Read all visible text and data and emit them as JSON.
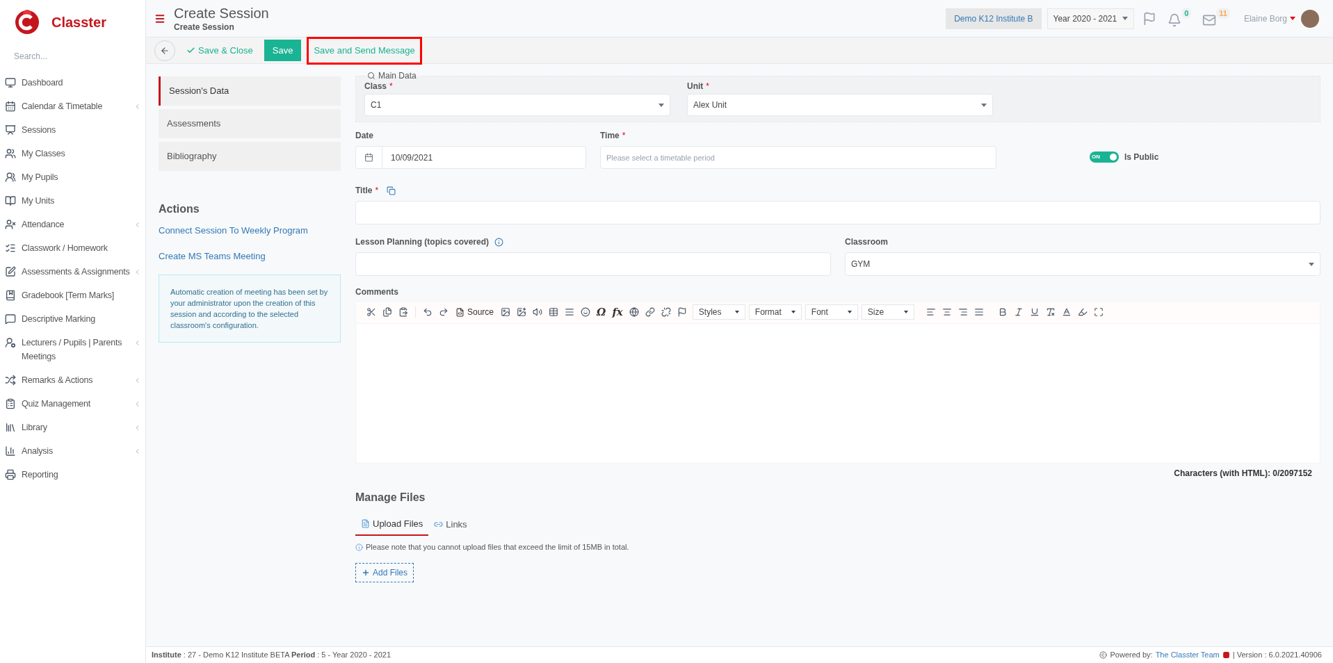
{
  "brand": {
    "name": "Classter"
  },
  "sidebar": {
    "search_placeholder": "Search...",
    "items": [
      {
        "label": "Dashboard",
        "has_submenu": false
      },
      {
        "label": "Calendar & Timetable",
        "has_submenu": true
      },
      {
        "label": "Sessions",
        "has_submenu": false
      },
      {
        "label": "My Classes",
        "has_submenu": false
      },
      {
        "label": "My Pupils",
        "has_submenu": false
      },
      {
        "label": "My Units",
        "has_submenu": false
      },
      {
        "label": "Attendance",
        "has_submenu": true
      },
      {
        "label": "Classwork / Homework",
        "has_submenu": false
      },
      {
        "label": "Assessments & Assignments",
        "has_submenu": true
      },
      {
        "label": "Gradebook [Term Marks]",
        "has_submenu": false
      },
      {
        "label": "Descriptive Marking",
        "has_submenu": false
      },
      {
        "label": "Lecturers / Pupils | Parents Meetings",
        "has_submenu": true
      },
      {
        "label": "Remarks & Actions",
        "has_submenu": true
      },
      {
        "label": "Quiz Management",
        "has_submenu": true
      },
      {
        "label": "Library",
        "has_submenu": true
      },
      {
        "label": "Analysis",
        "has_submenu": true
      },
      {
        "label": "Reporting",
        "has_submenu": false
      }
    ]
  },
  "header": {
    "title": "Create Session",
    "subtitle": "Create Session",
    "institute": "Demo K12 Institute B",
    "year": "Year 2020 - 2021",
    "badges": [
      {
        "count": "0",
        "color": "#1ab394"
      },
      {
        "count": "11",
        "color": "#f8ac59"
      }
    ],
    "user": "Elaine Borg"
  },
  "toolbar": {
    "save_close": "Save & Close",
    "save": "Save",
    "save_send": "Save and Send Message"
  },
  "sections": [
    {
      "label": "Session's Data",
      "selected": true
    },
    {
      "label": "Assessments",
      "selected": false
    },
    {
      "label": "Bibliography",
      "selected": false
    }
  ],
  "actions": {
    "title": "Actions",
    "links": [
      "Connect Session To Weekly Program",
      "Create MS Teams Meeting"
    ],
    "note": "Automatic creation of meeting has been set by your administrator upon the creation of this session and according to the selected classroom's configuration."
  },
  "main_data": {
    "legend": "Main Data",
    "class": {
      "label": "Class",
      "required_mark": "*",
      "value": "C1"
    },
    "unit": {
      "label": "Unit",
      "required_mark": "*",
      "value": "Alex Unit"
    }
  },
  "date": {
    "label": "Date",
    "value": "10/09/2021"
  },
  "time": {
    "label": "Time",
    "required_mark": "*",
    "placeholder": "Please select a timetable period"
  },
  "is_public": {
    "label": "Is Public",
    "on": true,
    "on_text": "ON"
  },
  "title_field": {
    "label": "Title",
    "required_mark": "*"
  },
  "lesson_planning": {
    "label": "Lesson Planning (topics covered)"
  },
  "classroom": {
    "label": "Classroom",
    "value": "GYM"
  },
  "comments": {
    "label": "Comments",
    "source": "Source",
    "symbols": [
      "Ω",
      "fx"
    ],
    "dropdowns": [
      "Styles",
      "Format",
      "Font",
      "Size"
    ],
    "counter": "Characters (with HTML): 0/2097152"
  },
  "files": {
    "title": "Manage Files",
    "tabs": [
      {
        "label": "Upload Files",
        "selected": true
      },
      {
        "label": "Links",
        "selected": false
      }
    ],
    "note": "Please note that you cannot upload files that exceed the limit of 15MB in total.",
    "add": "Add Files"
  },
  "footer": {
    "left": "**Institute** : 27 - Demo K12 Institute BETA **Period** : 5 - Year 2020 - 2021",
    "powered": "Powered by:",
    "team": "The Classter Team",
    "version": "| Version : 6.0.2021.40906"
  }
}
